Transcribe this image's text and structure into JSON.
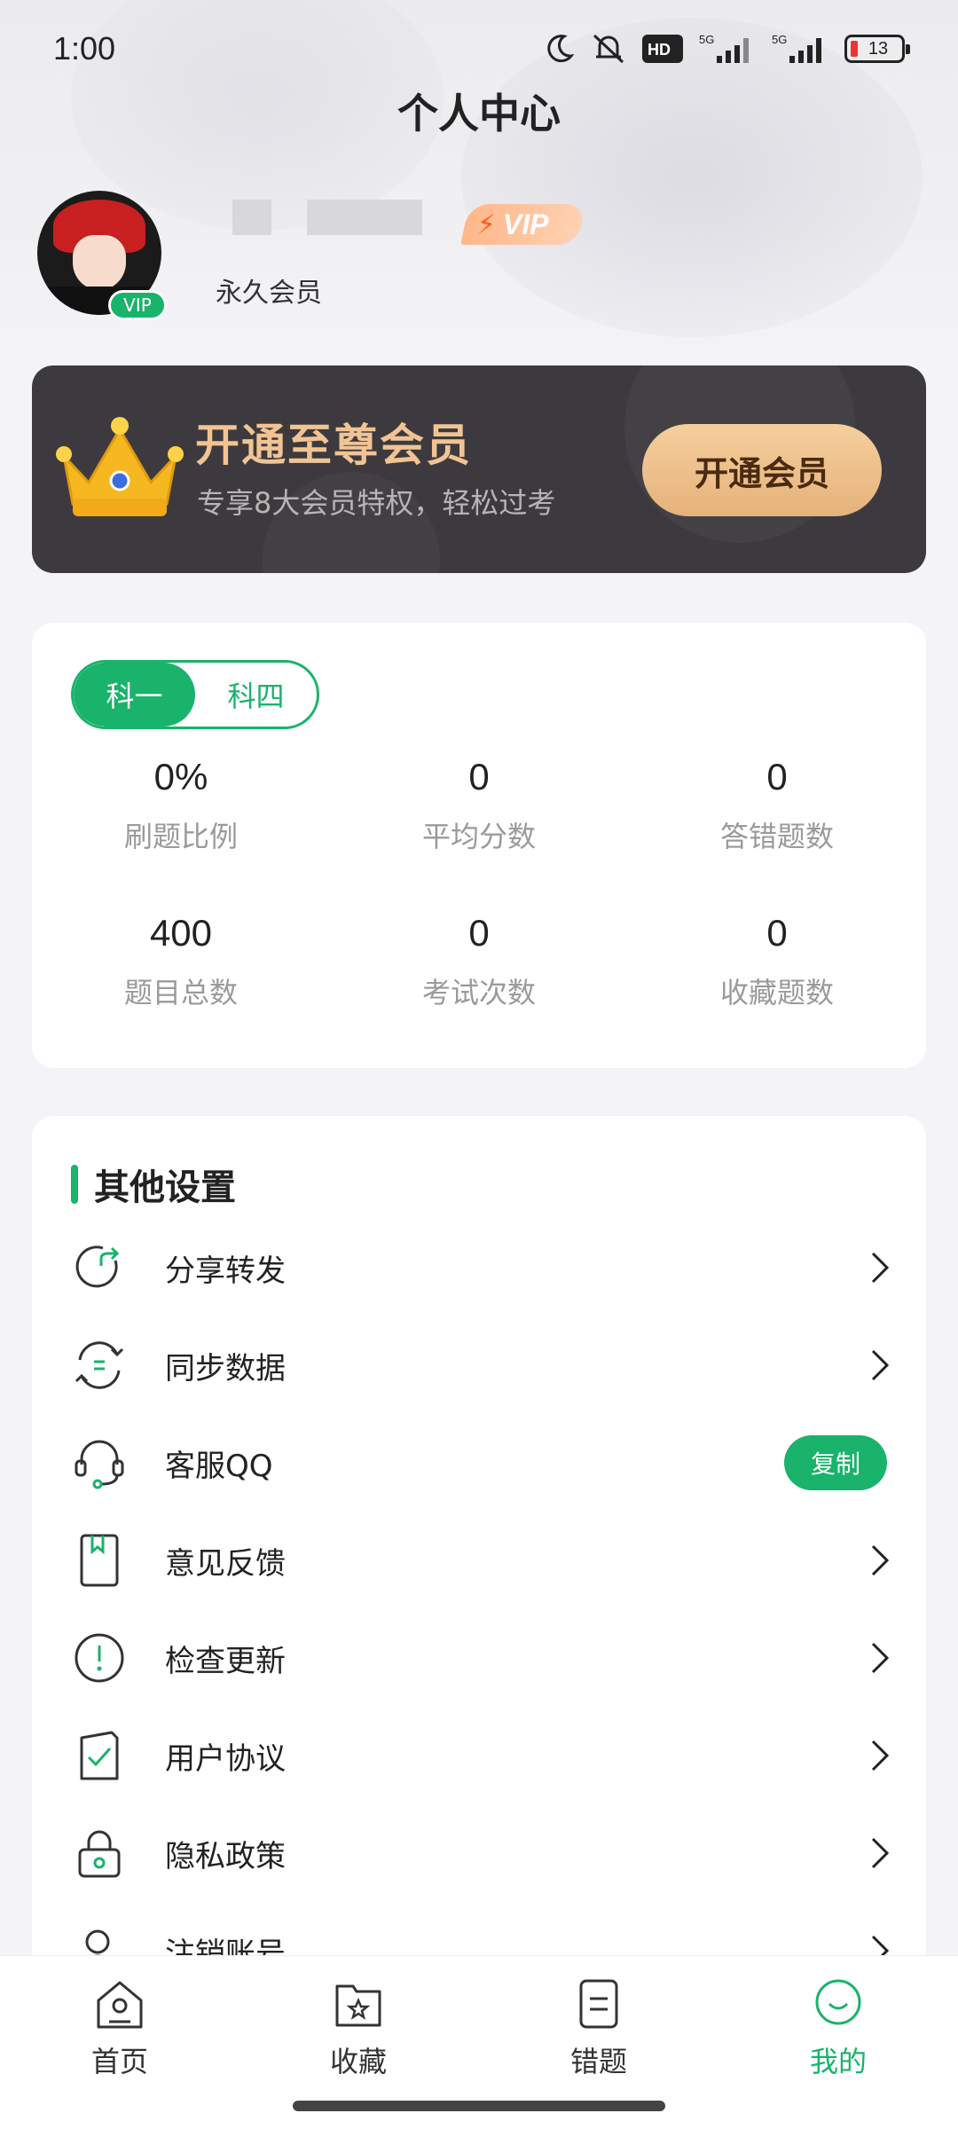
{
  "status_bar": {
    "time": "1:00",
    "battery": "13",
    "network_1": "5G",
    "network_2": "5G",
    "hd_label": "HD"
  },
  "page": {
    "title": "个人中心"
  },
  "profile": {
    "avatar_badge": "VIP",
    "vip_badge": "VIP",
    "member_type": "永久会员"
  },
  "promo": {
    "title": "开通至尊会员",
    "subtitle": "专享8大会员特权，轻松过考",
    "button": "开通会员"
  },
  "stats": {
    "tabs": [
      {
        "label": "科一",
        "active": true
      },
      {
        "label": "科四",
        "active": false
      }
    ],
    "items": [
      {
        "value": "0%",
        "label": "刷题比例"
      },
      {
        "value": "0",
        "label": "平均分数"
      },
      {
        "value": "0",
        "label": "答错题数"
      },
      {
        "value": "400",
        "label": "题目总数"
      },
      {
        "value": "0",
        "label": "考试次数"
      },
      {
        "value": "0",
        "label": "收藏题数"
      }
    ]
  },
  "settings": {
    "title": "其他设置",
    "rows": [
      {
        "label": "分享转发",
        "icon": "share-icon"
      },
      {
        "label": "同步数据",
        "icon": "sync-icon"
      },
      {
        "label": "客服QQ",
        "icon": "headset-icon",
        "action": "复制"
      },
      {
        "label": "意见反馈",
        "icon": "feedback-icon"
      },
      {
        "label": "检查更新",
        "icon": "update-icon"
      },
      {
        "label": "用户协议",
        "icon": "agreement-icon"
      },
      {
        "label": "隐私政策",
        "icon": "lock-icon"
      },
      {
        "label": "注销账号",
        "icon": "user-icon"
      }
    ]
  },
  "nav": {
    "items": [
      {
        "label": "首页",
        "icon": "home-icon"
      },
      {
        "label": "收藏",
        "icon": "favorites-folder-icon"
      },
      {
        "label": "错题",
        "icon": "wrong-questions-icon"
      },
      {
        "label": "我的",
        "icon": "profile-smile-icon",
        "active": true
      }
    ]
  },
  "colors": {
    "accent": "#19b36b",
    "promo_bg": "#3d3a3f",
    "promo_gold": "#f1c493"
  }
}
